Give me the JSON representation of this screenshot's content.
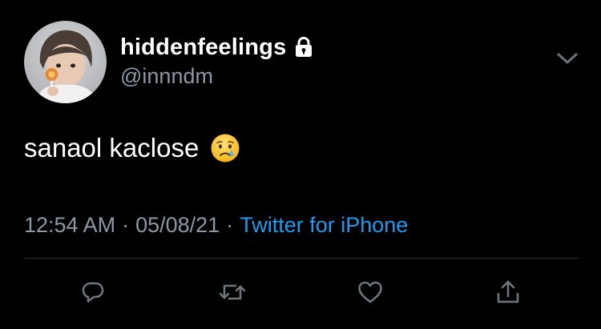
{
  "tweet": {
    "display_name": "hiddenfeelings",
    "handle": "@innndm",
    "text": "sanaol kaclose",
    "emoji": "crying-face-emoji",
    "time": "12:54 AM",
    "separator": "·",
    "date": "05/08/21",
    "source": "Twitter for iPhone",
    "protected_icon": "lock-icon",
    "menu_icon": "chevron-down-icon"
  },
  "actions": [
    {
      "icon": "reply-icon"
    },
    {
      "icon": "retweet-icon"
    },
    {
      "icon": "like-icon"
    },
    {
      "icon": "share-icon"
    }
  ],
  "colors": {
    "background": "#000000",
    "primary_text": "#ffffff",
    "secondary_text": "#8b98a5",
    "link": "#1d9bf0",
    "divider": "#2f3336"
  }
}
